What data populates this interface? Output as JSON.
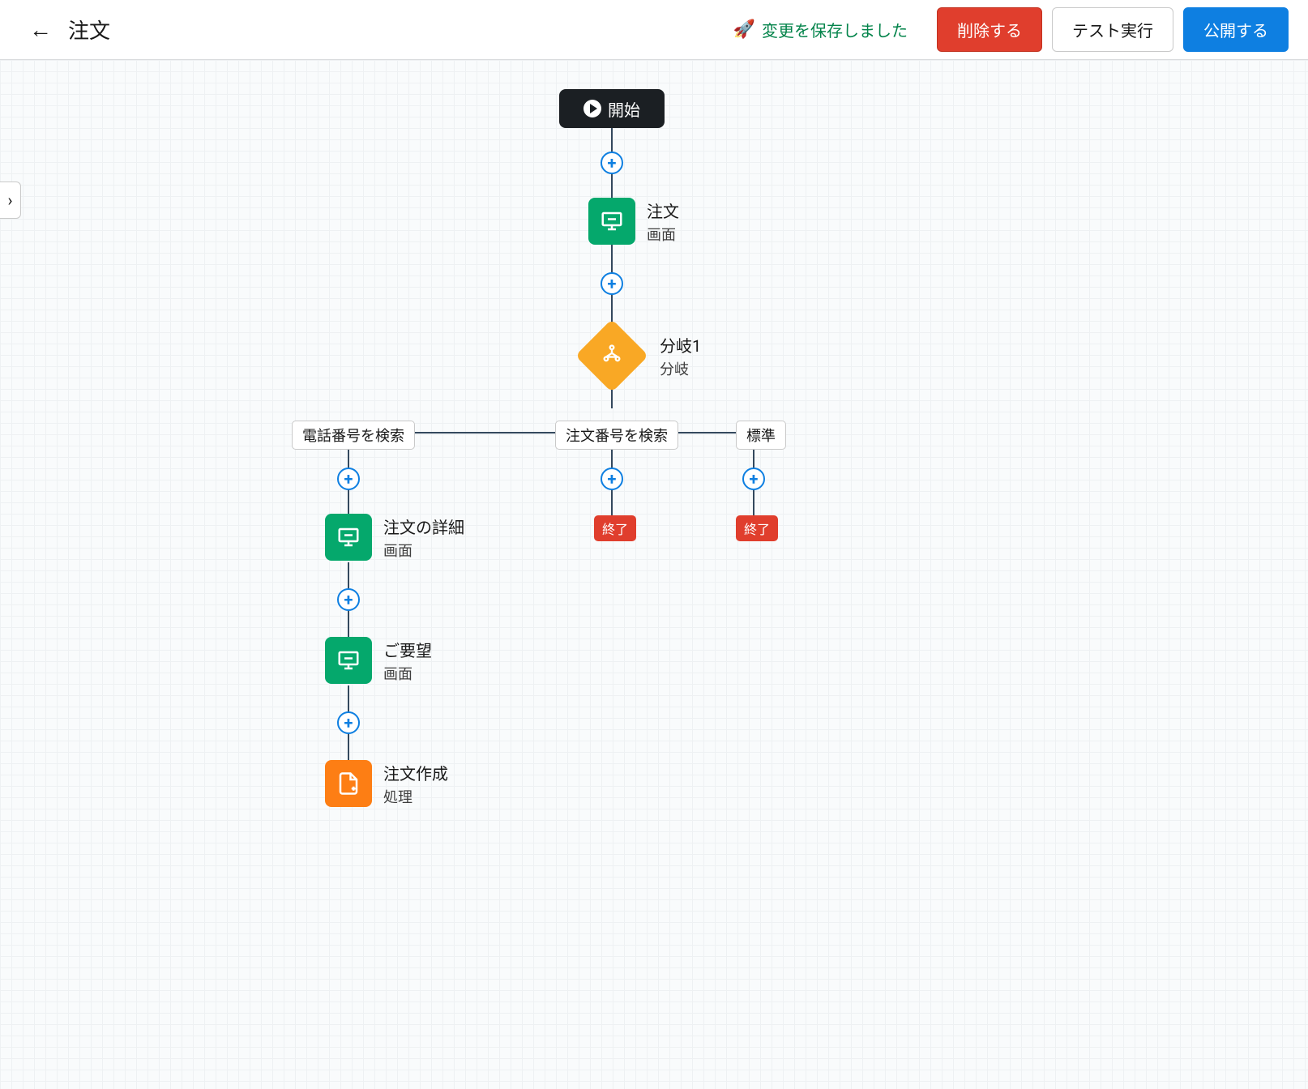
{
  "header": {
    "title": "注文",
    "save_status": "変更を保存しました",
    "delete_btn": "削除する",
    "test_btn": "テスト実行",
    "publish_btn": "公開する"
  },
  "nodes": {
    "start": {
      "label": "開始"
    },
    "order": {
      "title": "注文",
      "sub": "画面"
    },
    "branch": {
      "title": "分岐1",
      "sub": "分岐"
    },
    "order_detail": {
      "title": "注文の詳細",
      "sub": "画面"
    },
    "request": {
      "title": "ご要望",
      "sub": "画面"
    },
    "create_order": {
      "title": "注文作成",
      "sub": "処理"
    }
  },
  "branches": {
    "phone": "電話番号を検索",
    "order_no": "注文番号を検索",
    "default": "標準"
  },
  "end_label": "終了"
}
